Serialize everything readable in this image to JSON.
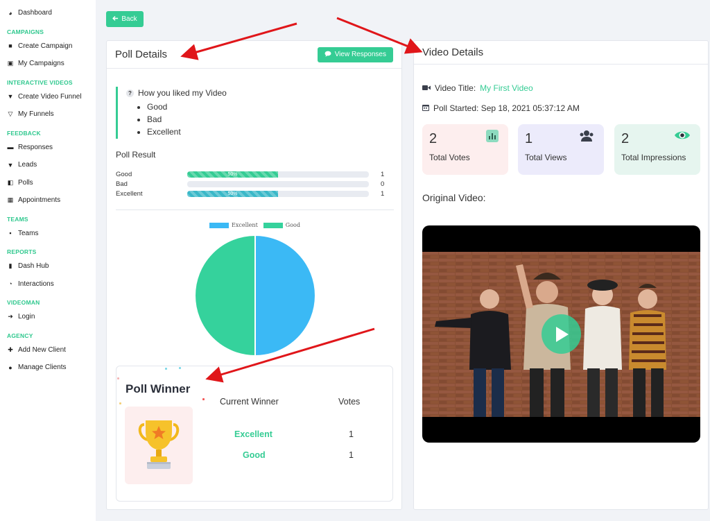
{
  "sidebar": {
    "items": [
      {
        "type": "item",
        "label": "Dashboard",
        "icon": "dashboard-icon",
        "glyph": "◕"
      },
      {
        "type": "head",
        "label": "CAMPAIGNS"
      },
      {
        "type": "item",
        "label": "Create Campaign",
        "icon": "campaign-icon",
        "glyph": "■"
      },
      {
        "type": "item",
        "label": "My Campaigns",
        "icon": "images-icon",
        "glyph": "▣"
      },
      {
        "type": "head",
        "label": "INTERACTIVE VIDEOS"
      },
      {
        "type": "item",
        "label": "Create Video Funnel",
        "icon": "funnel-icon",
        "glyph": "▼"
      },
      {
        "type": "item",
        "label": "My Funnels",
        "icon": "funnel-outline-icon",
        "glyph": "▽"
      },
      {
        "type": "head",
        "label": "FEEDBACK"
      },
      {
        "type": "item",
        "label": "Responses",
        "icon": "chat-icon",
        "glyph": "▬"
      },
      {
        "type": "item",
        "label": "Leads",
        "icon": "lead-funnel-icon",
        "glyph": "▼"
      },
      {
        "type": "item",
        "label": "Polls",
        "icon": "poll-icon",
        "glyph": "◧"
      },
      {
        "type": "item",
        "label": "Appointments",
        "icon": "calendar-icon",
        "glyph": "▦"
      },
      {
        "type": "head",
        "label": "TEAMS"
      },
      {
        "type": "item",
        "label": "Teams",
        "icon": "team-icon",
        "glyph": "▪"
      },
      {
        "type": "head",
        "label": "REPORTS"
      },
      {
        "type": "item",
        "label": "Dash Hub",
        "icon": "bar-chart-icon",
        "glyph": "▮"
      },
      {
        "type": "item",
        "label": "Interactions",
        "icon": "pie-icon",
        "glyph": "◔"
      },
      {
        "type": "head",
        "label": "VIDEOMAN"
      },
      {
        "type": "item",
        "label": "Login",
        "icon": "login-icon",
        "glyph": "➜"
      },
      {
        "type": "head",
        "label": "AGENCY"
      },
      {
        "type": "item",
        "label": "Add New Client",
        "icon": "add-user-icon",
        "glyph": "✚"
      },
      {
        "type": "item",
        "label": "Manage Clients",
        "icon": "user-icon",
        "glyph": "●"
      }
    ]
  },
  "back_label": "Back",
  "poll": {
    "title": "Poll Details",
    "view_responses_label": "View Responses",
    "question": "How you liked my Video",
    "question_badge": "?",
    "options": [
      "Good",
      "Bad",
      "Excellent"
    ],
    "result_title": "Poll Result",
    "results": [
      {
        "label": "Good",
        "percent": 50,
        "percent_label": "50%",
        "count": "1",
        "color": "#35cc94"
      },
      {
        "label": "Bad",
        "percent": 0,
        "percent_label": "",
        "count": "0",
        "color": "#35cc94"
      },
      {
        "label": "Excellent",
        "percent": 50,
        "percent_label": "50%",
        "count": "1",
        "color": "#3ab8c8"
      }
    ],
    "winner": {
      "title": "Poll Winner",
      "col_winner": "Current Winner",
      "col_votes": "Votes",
      "rows": [
        {
          "name": "Excellent",
          "votes": "1"
        },
        {
          "name": "Good",
          "votes": "1"
        }
      ]
    }
  },
  "chart_data": {
    "type": "pie",
    "labels": [
      "Excellent",
      "Good"
    ],
    "values": [
      1,
      1
    ],
    "colors": [
      "#3bb9f5",
      "#35d29c"
    ],
    "legend_position": "top"
  },
  "video": {
    "title": "Video Details",
    "video_title_label": "Video Title:",
    "video_title_value": "My First Video",
    "poll_started": "Poll Started: Sep 18, 2021 05:37:12 AM",
    "stats": [
      {
        "num": "2",
        "label": "Total Votes",
        "bg": "#fdeeee",
        "icon": "bar-chart-icon",
        "icon_color": "#7fd8b8"
      },
      {
        "num": "1",
        "label": "Total Views",
        "bg": "#ecebfb",
        "icon": "users-icon",
        "icon_color": "#3a3f4b"
      },
      {
        "num": "2",
        "label": "Total Impressions",
        "bg": "#e6f5ef",
        "icon": "eye-icon",
        "icon_color": "#35cc94"
      }
    ],
    "original_label": "Original Video:"
  },
  "colors": {
    "accent": "#35cc94",
    "arrow": "#e0161a"
  }
}
